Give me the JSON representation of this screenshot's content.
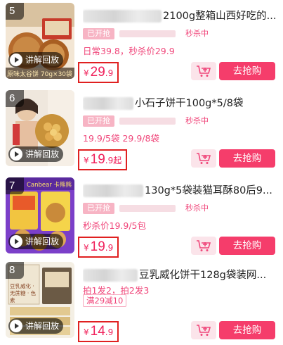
{
  "items": [
    {
      "rank": "5",
      "title_visible": "2100g整箱山西好吃的...",
      "status": "已开抢",
      "flash_label": "秒杀中",
      "subtitle": "日常39.8，秒杀价29.9",
      "coupon": "",
      "price": {
        "currency": "¥",
        "integer": "29",
        "decimal": ".9",
        "suffix": ""
      },
      "replay_label": "讲解回放",
      "buy_label": "去抢购",
      "cart_icon": "add-to-cart-icon",
      "thumb_text": "原味太谷饼 70g×30袋"
    },
    {
      "rank": "6",
      "title_visible": "小石子饼干100g*5/8袋",
      "status": "已开抢",
      "flash_label": "秒杀中",
      "subtitle": "19.9/5袋 29.9/8袋",
      "coupon": "",
      "price": {
        "currency": "¥",
        "integer": "19",
        "decimal": ".9",
        "suffix": "起"
      },
      "replay_label": "讲解回放",
      "buy_label": "去抢购",
      "cart_icon": "add-to-cart-icon",
      "thumb_text": ""
    },
    {
      "rank": "7",
      "title_visible": "130g*5袋装猫耳酥80后9...",
      "status": "已开抢",
      "flash_label": "秒杀中",
      "subtitle": "秒杀价19.9/5包",
      "coupon": "",
      "price": {
        "currency": "¥",
        "integer": "19",
        "decimal": ".9",
        "suffix": ""
      },
      "replay_label": "讲解回放",
      "buy_label": "去抢购",
      "cart_icon": "add-to-cart-icon",
      "thumb_text": "Canbear 卡熊熊"
    },
    {
      "rank": "8",
      "title_visible": "豆乳威化饼干128g袋装网...",
      "status": "",
      "flash_label": "",
      "subtitle": "拍1发2，拍2发3",
      "coupon": "满29减10",
      "price": {
        "currency": "¥",
        "integer": "14",
        "decimal": ".9",
        "suffix": ""
      },
      "replay_label": "讲解回放",
      "buy_label": "去抢购",
      "cart_icon": "add-to-cart-icon",
      "thumb_text": "豆乳威化 · 无蔗糖 · 色素"
    }
  ],
  "colors": {
    "accent": "#f53d6b",
    "price": "#f0205a",
    "highlight_border": "#e02020"
  }
}
